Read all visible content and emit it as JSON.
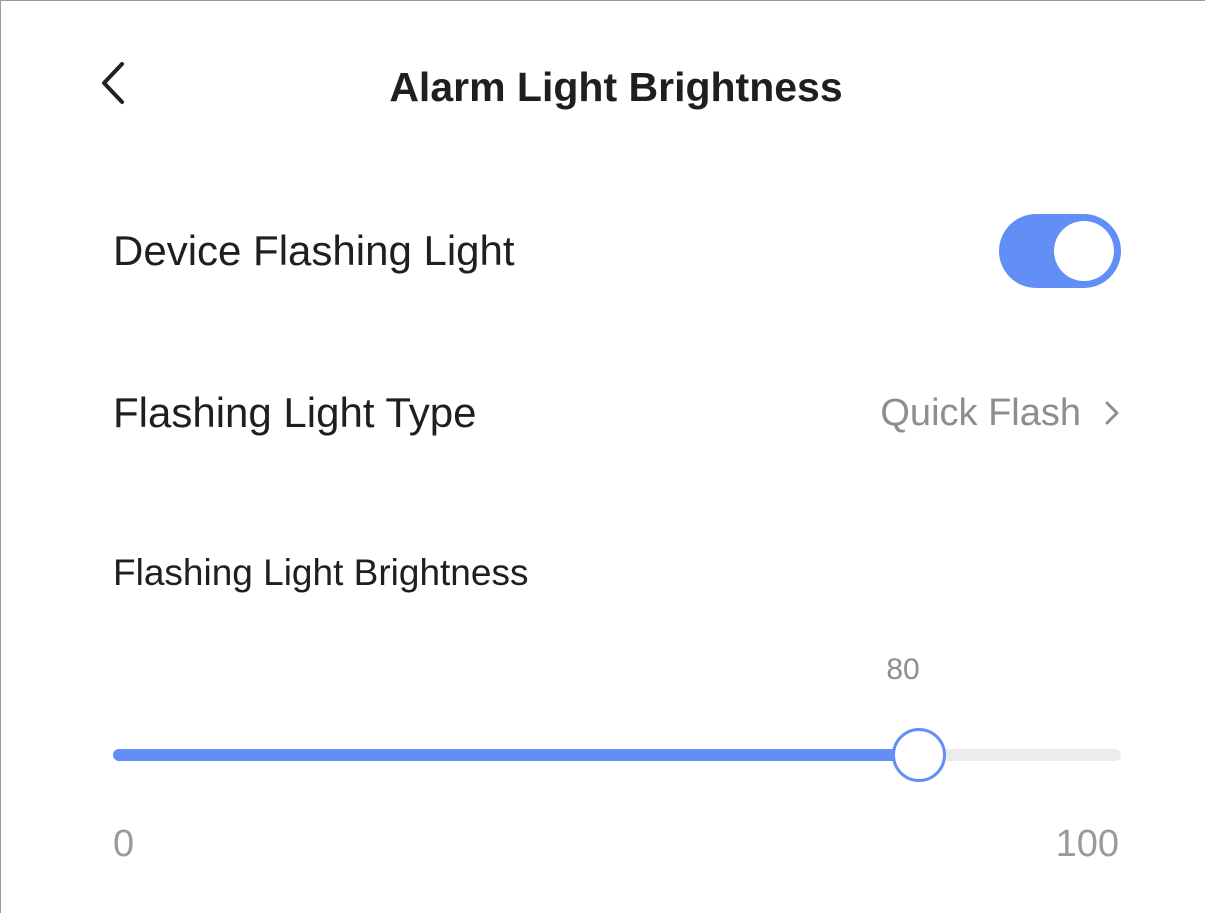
{
  "header": {
    "title": "Alarm Light Brightness",
    "back_icon": "chevron-left-icon"
  },
  "settings": {
    "device_flashing_light": {
      "label": "Device Flashing Light",
      "enabled": true,
      "accent_color": "#628ff5"
    },
    "flashing_light_type": {
      "label": "Flashing Light Type",
      "value": "Quick Flash",
      "chevron_icon": "chevron-right-icon"
    }
  },
  "brightness": {
    "section_title": "Flashing Light Brightness",
    "value": 80,
    "min": 0,
    "max": 100,
    "min_label": "0",
    "max_label": "100",
    "value_label": "80"
  },
  "colors": {
    "accent": "#628ff5",
    "track": "#ececec",
    "secondary_text": "#8e8e8e"
  }
}
